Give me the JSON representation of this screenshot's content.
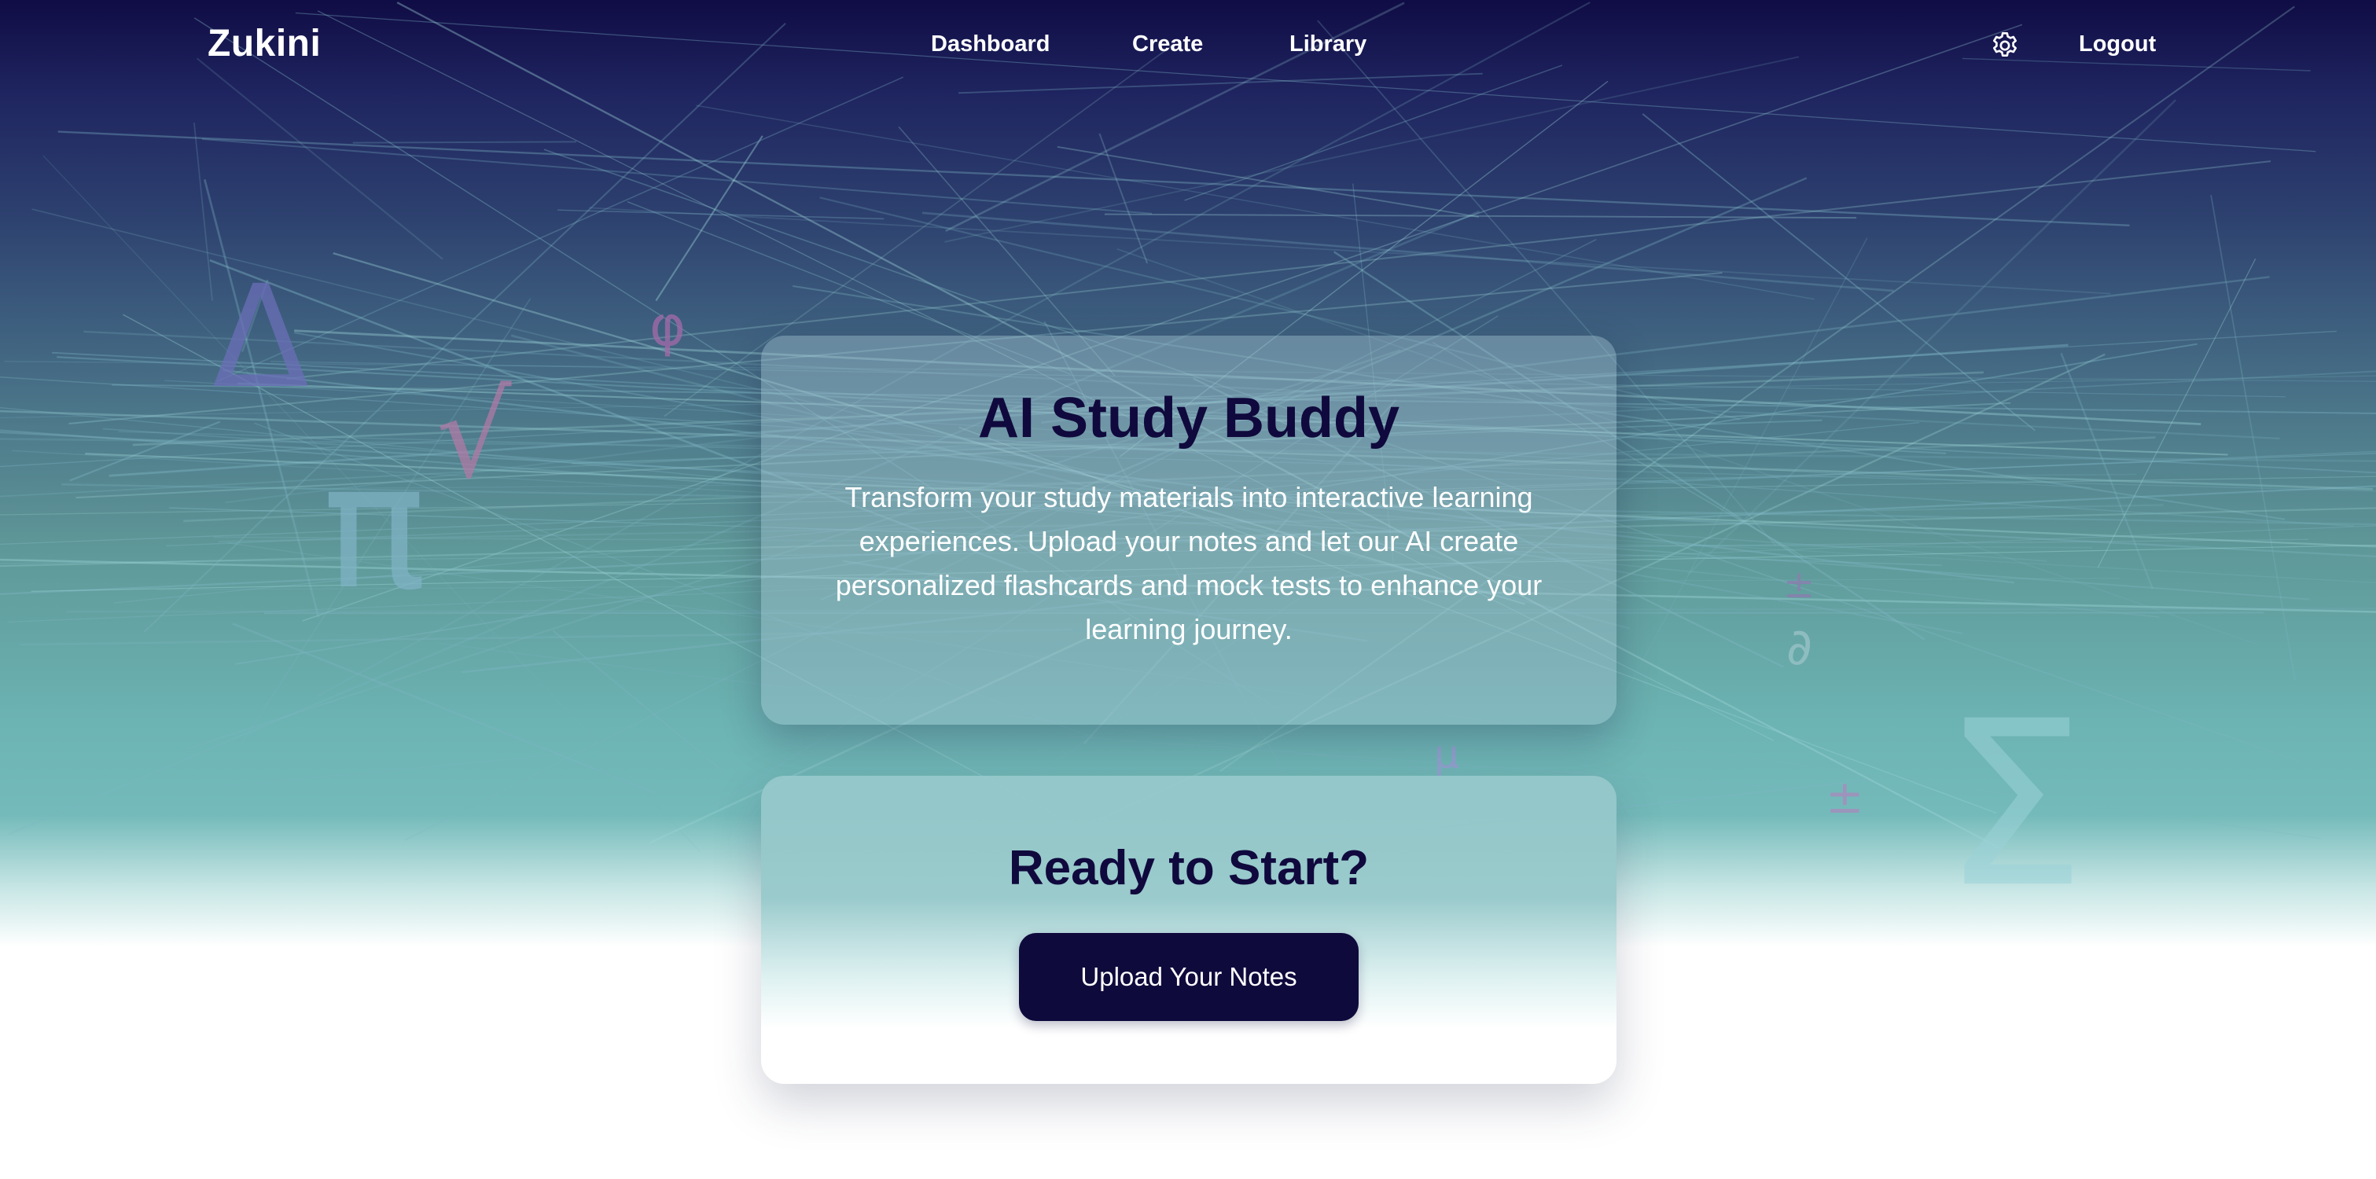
{
  "nav": {
    "brand": "Zukini",
    "links": [
      "Dashboard",
      "Create",
      "Library"
    ],
    "settings_icon": "gear-icon",
    "logout": "Logout"
  },
  "background": {
    "symbols": [
      "Δ",
      "φ",
      "π",
      "√",
      "±",
      "∂",
      "±",
      "Σ",
      "μ"
    ]
  },
  "hero": {
    "title": "AI Study Buddy",
    "description": "Transform your study materials into interactive learning experiences. Upload your notes and let our AI create personalized flashcards and mock tests to enhance your learning journey."
  },
  "cta": {
    "title": "Ready to Start?",
    "button_label": "Upload Your Notes"
  },
  "colors": {
    "navy": "#10093d",
    "button": "#0f0a3c",
    "teal": "#6cb3b3"
  }
}
